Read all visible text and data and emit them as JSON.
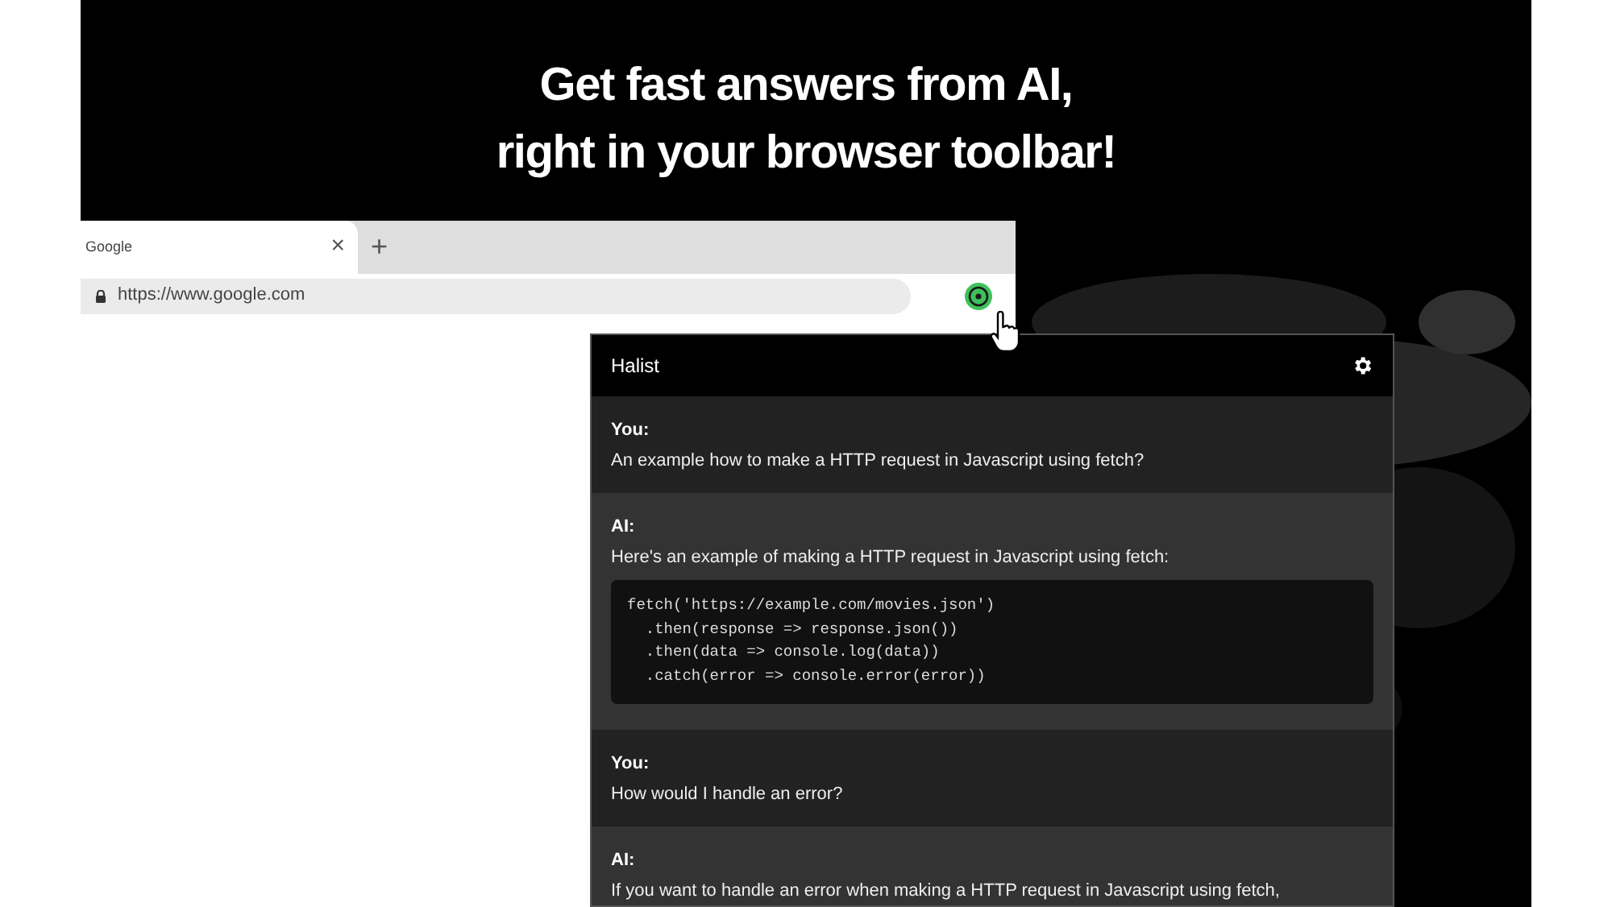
{
  "headline": [
    "Get fast answers from AI,",
    "right in your browser toolbar!"
  ],
  "browser": {
    "tab": {
      "title": "Google",
      "close": "×",
      "selected": true
    },
    "new_tab": "+",
    "address": "https://www.google.com"
  },
  "popup": {
    "title": "Halist",
    "messages": [
      {
        "kind": "you",
        "label": "You:",
        "text": "An example how to make a HTTP request in Javascript using fetch?"
      },
      {
        "kind": "ai",
        "label": "AI:",
        "text": "Here's an example of making a HTTP request in Javascript using fetch:",
        "code": [
          "fetch('https://example.com/movies.json')",
          "  .then(response => response.json())",
          "  .then(data => console.log(data))",
          "  .catch(error => console.error(error))"
        ]
      },
      {
        "kind": "you",
        "label": "You:",
        "text": "How would I handle an error?"
      },
      {
        "kind": "ai",
        "label": "AI:",
        "text": "If you want to handle an error when making a HTTP request in Javascript using fetch,"
      }
    ]
  }
}
